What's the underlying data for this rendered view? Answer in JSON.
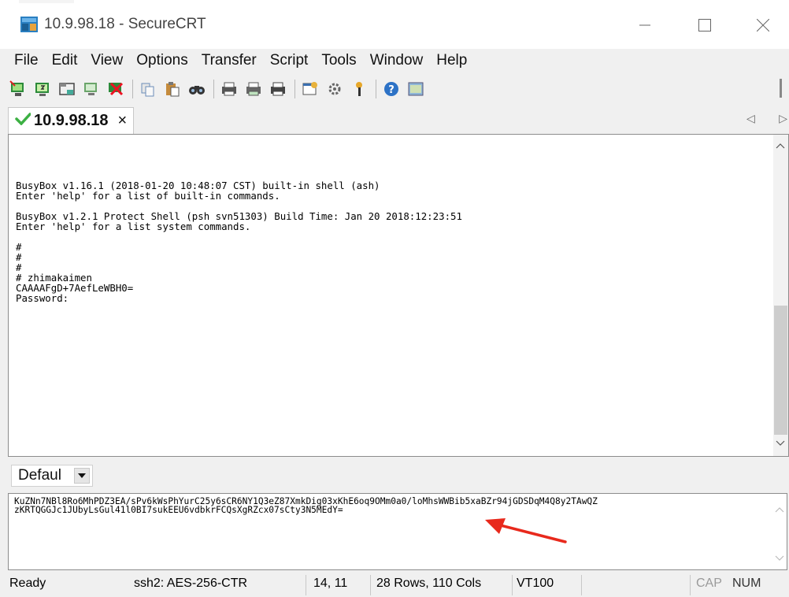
{
  "window": {
    "title": "10.9.98.18 - SecureCRT"
  },
  "menu": [
    "File",
    "Edit",
    "View",
    "Options",
    "Transfer",
    "Script",
    "Tools",
    "Window",
    "Help"
  ],
  "toolbar": {
    "icons": [
      "connect-icon",
      "quick-connect-icon",
      "connect-in-tab-icon",
      "reconnect-icon",
      "disconnect-icon",
      "copy-icon",
      "paste-icon",
      "find-icon",
      "print-setup-icon",
      "print-selection-icon",
      "print-icon",
      "session-options-icon",
      "global-options-icon",
      "keymap-icon",
      "help-icon",
      "log-session-icon"
    ]
  },
  "tab": {
    "label": "10.9.98.18",
    "close": "×",
    "status_color": "#3cb043"
  },
  "terminal": {
    "lines": [
      "BusyBox v1.16.1 (2018-01-20 10:48:07 CST) built-in shell (ash)",
      "Enter 'help' for a list of built-in commands.",
      "",
      "BusyBox v1.2.1 Protect Shell (psh svn51303) Build Time: Jan 20 2018:12:23:51",
      "Enter 'help' for a list system commands.",
      "",
      "#",
      "#",
      "#",
      "# zhimakaimen",
      "CAAAAFgD+7AefLeWBH0=",
      "Password:"
    ]
  },
  "session_select": {
    "value": "Defaul"
  },
  "command_window": {
    "lines": [
      "KuZNn7NBl8Ro6MhPDZ3EA/sPv6kWsPhYurC25y6sCR6NY1Q3eZ87XmkDig03xKhE6oq9OMm0a0/loMhsWWBib5xaBZr94jGDSDqM4Q8y2TAwQZ",
      "zKRTQGGJc1JUbyLsGul41l0BI7sukEEU6vdbkrFCQsXgRZcx07sCty3N5MEdY="
    ]
  },
  "status": {
    "ready": "Ready",
    "encryption": "ssh2: AES-256-CTR",
    "position": "14,  11",
    "dimensions": "28 Rows, 110 Cols",
    "terminal_type": "VT100",
    "cap": "CAP",
    "num": "NUM"
  },
  "annotation": {
    "arrow_color": "#e8291c"
  }
}
